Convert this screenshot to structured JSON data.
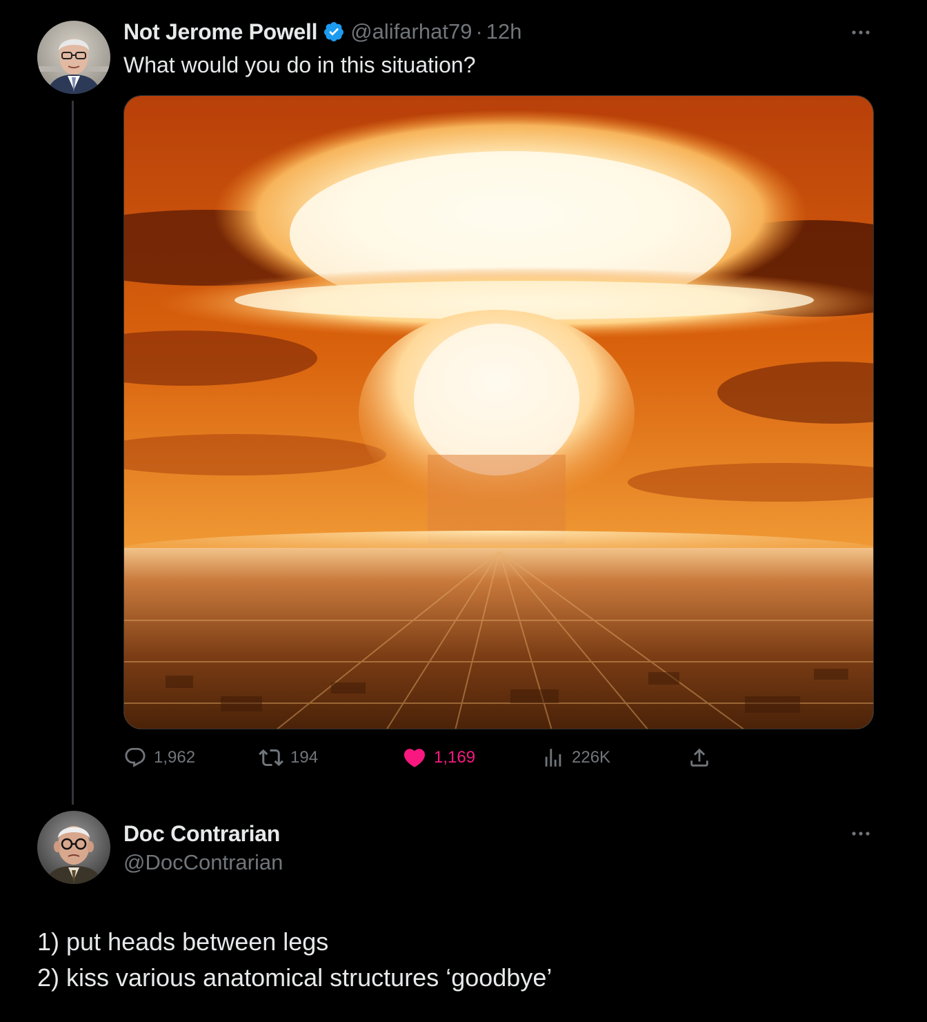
{
  "tweet": {
    "author_name": "Not Jerome Powell",
    "handle": "@alifarhat79",
    "separator": "·",
    "time": "12h",
    "text": "What would you do in this situation?",
    "stats": {
      "replies": "1,962",
      "retweets": "194",
      "likes": "1,169",
      "views": "226K"
    },
    "colors": {
      "verified": "#1d9bf0",
      "like_accent": "#f91880",
      "muted": "#71767b"
    },
    "icons": [
      "reply-icon",
      "retweet-icon",
      "heart-icon",
      "views-icon",
      "share-icon",
      "more-icon",
      "verified-badge-icon"
    ]
  },
  "reply": {
    "author_name": "Doc Contrarian",
    "handle": "@DocContrarian",
    "lines": [
      "1)  put heads between legs",
      "2)  kiss various anatomical structures ‘goodbye’"
    ]
  }
}
